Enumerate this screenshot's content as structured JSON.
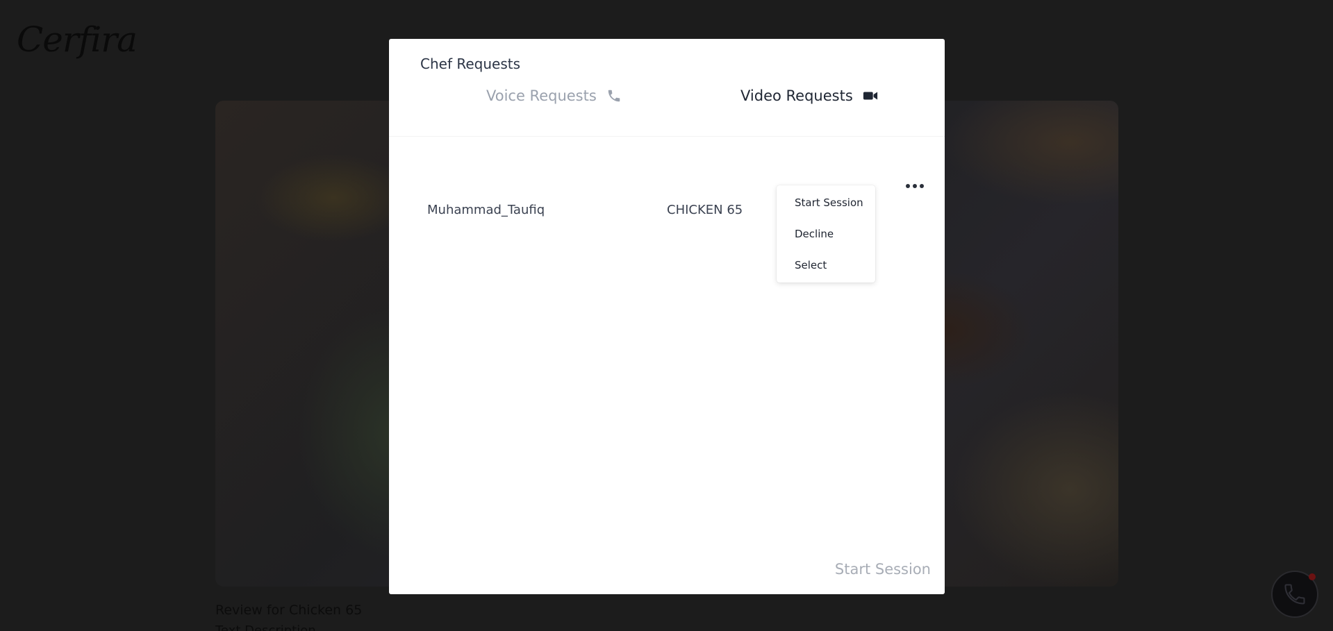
{
  "page": {
    "logo": "Cerfira",
    "review_title": "Review for Chicken 65",
    "review_desc": "Text Description"
  },
  "modal": {
    "title": "Chef Requests",
    "tabs": [
      {
        "label": "Voice Requests",
        "icon": "phone-icon",
        "active": false
      },
      {
        "label": "Video Requests",
        "icon": "video-camera-icon",
        "active": true
      }
    ],
    "rows": [
      {
        "name": "Muhammad_Taufiq",
        "dish": "CHICKEN 65"
      }
    ],
    "row_menu": {
      "items": [
        "Start Session",
        "Decline",
        "Select"
      ]
    },
    "footer_button": "Start Session"
  },
  "colors": {
    "overlay": "#1c1c1c",
    "active_tab": "#1f2633",
    "inactive_tab": "#9aa1ad",
    "disabled_button": "#a8adb6"
  }
}
